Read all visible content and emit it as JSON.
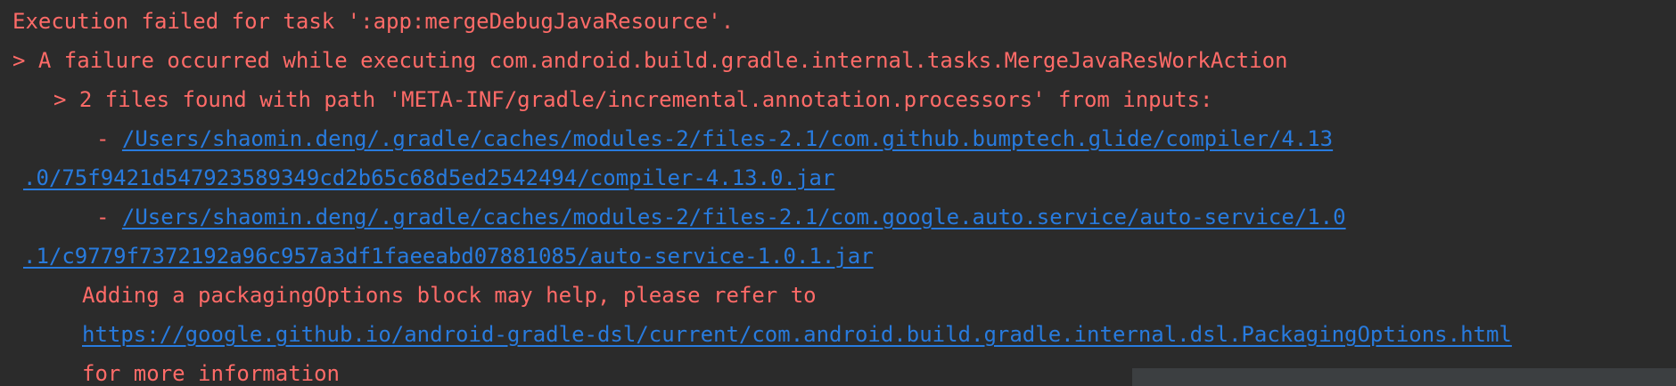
{
  "console": {
    "lines": {
      "execution_failed": "Execution failed for task ':app:mergeDebugJavaResource'.",
      "failure_occurred": "> A failure occurred while executing com.android.build.gradle.internal.tasks.MergeJavaResWorkAction",
      "files_found": "> 2 files found with path 'META-INF/gradle/incremental.annotation.processors' from inputs:",
      "dash1": "- ",
      "path1_part1": "/Users/shaomin.deng/.gradle/caches/modules-2/files-2.1/com.github.bumptech.glide/compiler/4.13",
      "path1_part2": ".0/75f9421d547923589349cd2b65c68d5ed2542494/compiler-4.13.0.jar",
      "dash2": "- ",
      "path2_part1": "/Users/shaomin.deng/.gradle/caches/modules-2/files-2.1/com.google.auto.service/auto-service/1.0",
      "path2_part2": ".1/c9779f7372192a96c957a3df1faeeabd07881085/auto-service-1.0.1.jar",
      "adding_block": "Adding a packagingOptions block may help, please refer to",
      "docs_link": "https://google.github.io/android-gradle-dsl/current/com.android.build.gradle.internal.dsl.PackagingOptions.html",
      "more_info": "for more information"
    }
  },
  "colors": {
    "background": "#2b2b2b",
    "error_text": "#ff6b68",
    "link": "#287bde"
  }
}
